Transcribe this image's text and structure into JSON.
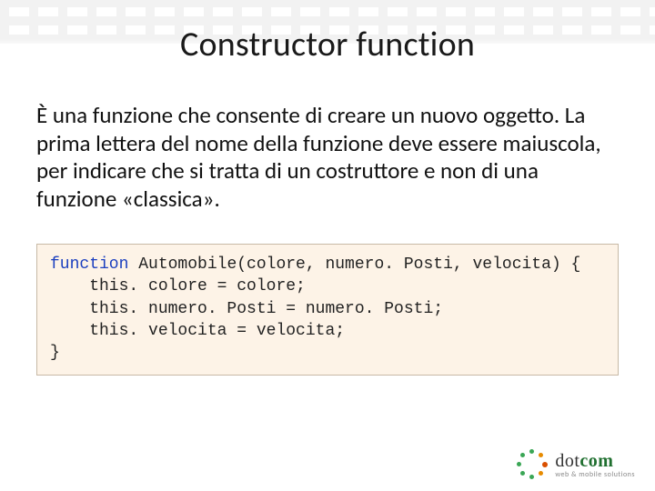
{
  "title": "Constructor function",
  "body": "È una funzione che consente di creare un nuovo oggetto. La prima lettera del nome della funzione deve essere maiuscola, per indicare che si tratta di un costruttore e non di una funzione «classica».",
  "code": {
    "keyword": "function",
    "signature": " Automobile(colore, numero. Posti, velocita) {",
    "line1": "    this. colore = colore;",
    "line2": "    this. numero. Posti = numero. Posti;",
    "line3": "    this. velocita = velocita;",
    "close": "}"
  },
  "logo": {
    "dot": "dot",
    "com": "com",
    "tagline": "web & mobile solutions"
  }
}
